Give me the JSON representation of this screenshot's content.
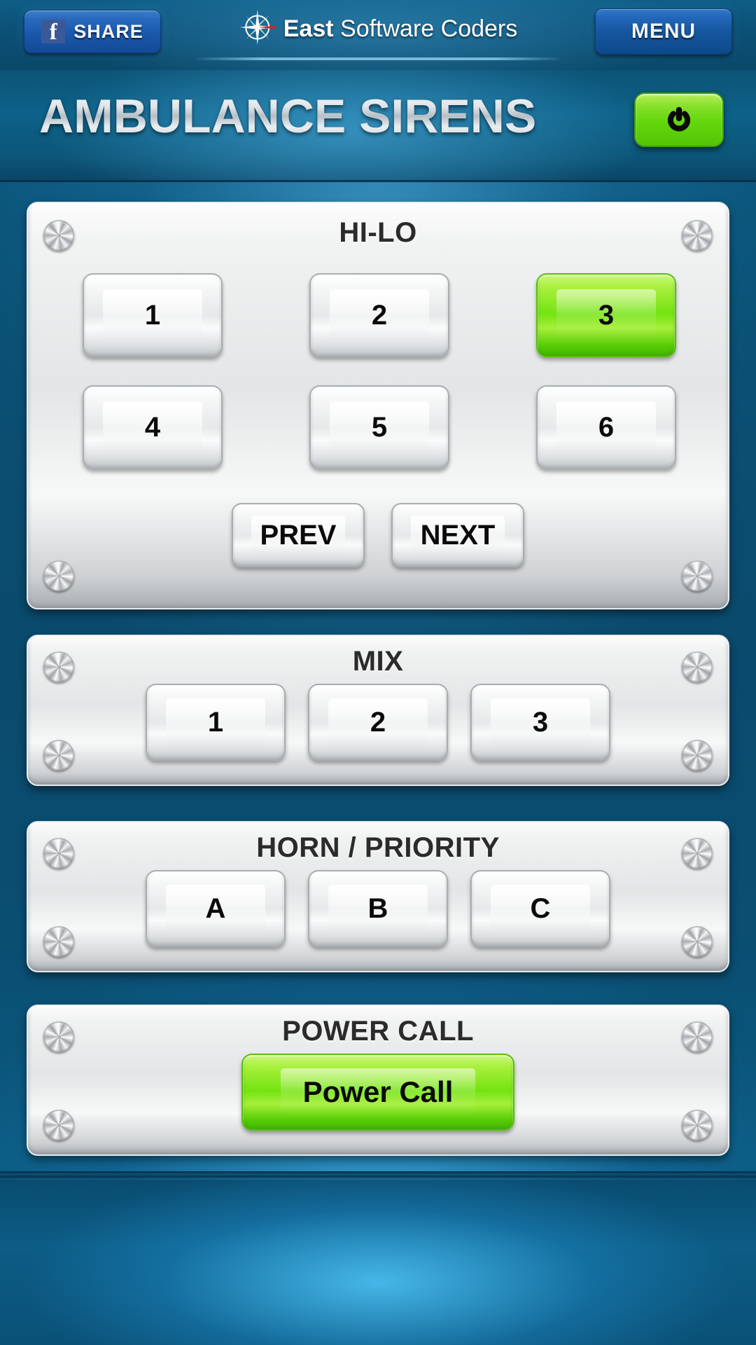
{
  "header": {
    "share_button": {
      "label": "SHARE",
      "icon": "facebook-icon",
      "glyph": "f"
    },
    "brand": {
      "bold_text": "East",
      "light_text": " Software Coders",
      "icon": "compass-rose-icon"
    },
    "menu_button": {
      "label": "MENU"
    }
  },
  "title_bar": {
    "app_title": "AMBULANCE SIRENS",
    "power_button": {
      "icon": "power-icon",
      "state": "on",
      "color": "#74e312"
    }
  },
  "panels": [
    {
      "id": "hilo",
      "title": "HI-LO",
      "buttons": [
        {
          "label": "1",
          "active": false
        },
        {
          "label": "2",
          "active": false
        },
        {
          "label": "3",
          "active": true
        },
        {
          "label": "4",
          "active": false
        },
        {
          "label": "5",
          "active": false
        },
        {
          "label": "6",
          "active": false
        }
      ],
      "nav": [
        {
          "label": "PREV"
        },
        {
          "label": "NEXT"
        }
      ]
    },
    {
      "id": "mix",
      "title": "MIX",
      "buttons": [
        {
          "label": "1",
          "active": false
        },
        {
          "label": "2",
          "active": false
        },
        {
          "label": "3",
          "active": false
        }
      ]
    },
    {
      "id": "horn",
      "title": "HORN / PRIORITY",
      "buttons": [
        {
          "label": "A",
          "active": false
        },
        {
          "label": "B",
          "active": false
        },
        {
          "label": "C",
          "active": false
        }
      ]
    },
    {
      "id": "power",
      "title": "POWER CALL",
      "buttons": [
        {
          "label": "Power Call",
          "active": true
        }
      ]
    }
  ],
  "colors": {
    "background_blue": "#0a4e72",
    "header_blue": "#0c5076",
    "accent_green": "#74e312",
    "button_blue": "#1b58ab",
    "panel_silver": "#e3e5e6"
  },
  "screw_icon": "screw-icon"
}
